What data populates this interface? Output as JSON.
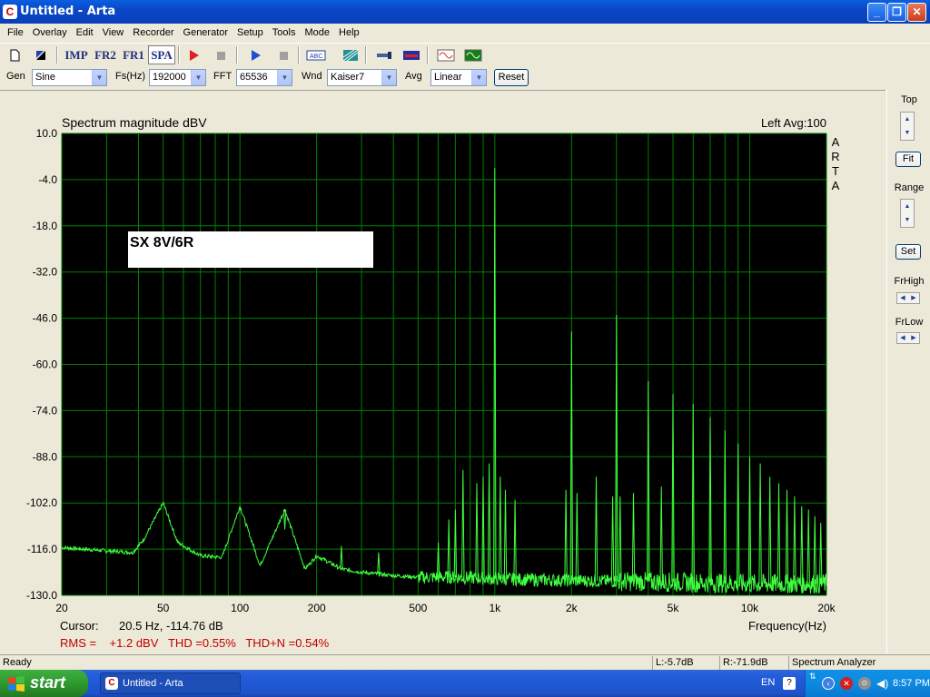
{
  "window": {
    "title": "Untitled - Arta",
    "app_icon": "C"
  },
  "menu": [
    "File",
    "Overlay",
    "Edit",
    "View",
    "Recorder",
    "Generator",
    "Setup",
    "Tools",
    "Mode",
    "Help"
  ],
  "toolbar": {
    "imp": "IMP",
    "fr2": "FR2",
    "fr1": "FR1",
    "spa": "SPA"
  },
  "settings": {
    "gen_label": "Gen",
    "gen_value": "Sine",
    "fs_label": "Fs(Hz)",
    "fs_value": "192000",
    "fft_label": "FFT",
    "fft_value": "65536",
    "wnd_label": "Wnd",
    "wnd_value": "Kaiser7",
    "avg_label": "Avg",
    "avg_value": "Linear",
    "reset_label": "Reset"
  },
  "plot": {
    "title": "Spectrum magnitude dBV",
    "channel_info": "Left  Avg:100",
    "side_label": [
      "A",
      "R",
      "T",
      "A"
    ],
    "annotation": "SX 8V/6R",
    "xlabel": "Frequency(Hz)",
    "cursor_label": "Cursor:",
    "cursor_value": "20.5 Hz, -114.76 dB",
    "rms_text": "RMS =    +1.2 dBV   THD =0.55%   THD+N =0.54%",
    "bg_color": "#000000",
    "grid_color": "#008000",
    "trace_color": "#40FF40"
  },
  "chart_data": {
    "type": "line",
    "title": "Spectrum magnitude dBV",
    "xlabel": "Frequency(Hz)",
    "ylabel": "",
    "xscale": "log",
    "xlim": [
      20,
      20000
    ],
    "ylim": [
      -130,
      10
    ],
    "y_ticks": [
      "10.0",
      "-4.0",
      "-18.0",
      "-32.0",
      "-46.0",
      "-60.0",
      "-74.0",
      "-88.0",
      "-102.0",
      "-116.0",
      "-130.0"
    ],
    "x_ticks": [
      {
        "v": 20,
        "label": "20"
      },
      {
        "v": 50,
        "label": "50"
      },
      {
        "v": 100,
        "label": "100"
      },
      {
        "v": 200,
        "label": "200"
      },
      {
        "v": 500,
        "label": "500"
      },
      {
        "v": 1000,
        "label": "1k"
      },
      {
        "v": 2000,
        "label": "2k"
      },
      {
        "v": 5000,
        "label": "5k"
      },
      {
        "v": 10000,
        "label": "10k"
      },
      {
        "v": 20000,
        "label": "20k"
      }
    ],
    "noise_floor": [
      [
        20,
        -115.5
      ],
      [
        30,
        -116.5
      ],
      [
        38,
        -117
      ],
      [
        42,
        -113
      ],
      [
        50,
        -102
      ],
      [
        57,
        -114
      ],
      [
        70,
        -118
      ],
      [
        85,
        -118.5
      ],
      [
        100,
        -103
      ],
      [
        120,
        -121
      ],
      [
        150,
        -104
      ],
      [
        180,
        -122
      ],
      [
        200,
        -118
      ],
      [
        250,
        -122
      ],
      [
        300,
        -123
      ],
      [
        400,
        -124
      ],
      [
        500,
        -124.5
      ],
      [
        700,
        -124.5
      ],
      [
        1000,
        -125
      ],
      [
        2000,
        -125.5
      ],
      [
        5000,
        -126
      ],
      [
        10000,
        -126.5
      ],
      [
        20000,
        -126.5
      ]
    ],
    "peaks": [
      {
        "f": 1000,
        "db": -0.5
      },
      {
        "f": 2000,
        "db": -50
      },
      {
        "f": 3000,
        "db": -45
      },
      {
        "f": 4000,
        "db": -65
      },
      {
        "f": 5000,
        "db": -69
      },
      {
        "f": 6000,
        "db": -72
      },
      {
        "f": 7000,
        "db": -76
      },
      {
        "f": 8000,
        "db": -80
      },
      {
        "f": 9000,
        "db": -84
      },
      {
        "f": 10000,
        "db": -88
      },
      {
        "f": 11000,
        "db": -90
      },
      {
        "f": 12000,
        "db": -94
      },
      {
        "f": 13000,
        "db": -96
      },
      {
        "f": 14000,
        "db": -98
      },
      {
        "f": 15000,
        "db": -100
      },
      {
        "f": 16000,
        "db": -103
      },
      {
        "f": 17000,
        "db": -104
      },
      {
        "f": 18000,
        "db": -106
      },
      {
        "f": 19000,
        "db": -108
      },
      {
        "f": 750,
        "db": -92
      },
      {
        "f": 850,
        "db": -96
      },
      {
        "f": 900,
        "db": -94
      },
      {
        "f": 950,
        "db": -90
      },
      {
        "f": 1050,
        "db": -94
      },
      {
        "f": 1100,
        "db": -98
      },
      {
        "f": 1200,
        "db": -101
      },
      {
        "f": 1900,
        "db": -98
      },
      {
        "f": 2100,
        "db": -99
      },
      {
        "f": 2500,
        "db": -94
      },
      {
        "f": 2900,
        "db": -100
      },
      {
        "f": 3100,
        "db": -100
      },
      {
        "f": 3500,
        "db": -99
      },
      {
        "f": 4500,
        "db": -97
      },
      {
        "f": 660,
        "db": -107
      },
      {
        "f": 700,
        "db": -104
      },
      {
        "f": 600,
        "db": -114
      },
      {
        "f": 150,
        "db": -110
      },
      {
        "f": 250,
        "db": -115
      },
      {
        "f": 350,
        "db": -117
      }
    ]
  },
  "right_panel": {
    "top_label": "Top",
    "fit_label": "Fit",
    "range_label": "Range",
    "set_label": "Set",
    "frhigh_label": "FrHigh",
    "frlow_label": "FrLow"
  },
  "status": {
    "ready": "Ready",
    "left": "L:-5.7dB",
    "right": "R:-71.9dB",
    "mode": "Spectrum Analyzer"
  },
  "taskbar": {
    "start": "start",
    "item": "Untitled - Arta",
    "lang": "EN",
    "time": "8:57 PM"
  }
}
